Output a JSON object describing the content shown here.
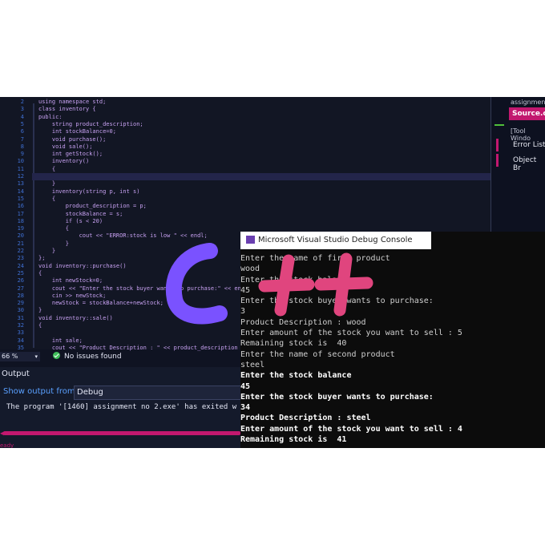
{
  "editor": {
    "line_numbers": [
      "2",
      "3",
      "4",
      "5",
      "6",
      "7",
      "8",
      "9",
      "10",
      "11",
      "12",
      "13",
      "14",
      "15",
      "16",
      "17",
      "18",
      "19",
      "20",
      "21",
      "22",
      "23",
      "24",
      "25",
      "26",
      "27",
      "28",
      "29",
      "30",
      "31",
      "32",
      "33",
      "34",
      "35"
    ],
    "lines": [
      "using namespace std;",
      "class inventory {",
      "public:",
      "    string product_description;",
      "    int stockBalance=0;",
      "    void purchase();",
      "    void sale();",
      "    int getStock();",
      "    inventory()",
      "    {",
      "",
      "    }",
      "    inventory(string p, int s)",
      "    {",
      "        product_description = p;",
      "        stockBalance = s;",
      "        if (s < 20)",
      "        {",
      "            cout << \"ERROR:stock is low \" << endl;",
      "        }",
      "    }",
      "};",
      "void inventory::purchase()",
      "{",
      "    int newStock=0;",
      "    cout << \"Enter the stock buyer wants to purchase:\" << endl;",
      "    cin >> newStock;",
      "    newStock = stockBalance+newStock;",
      "}",
      "void inventory::sale()",
      "{",
      "",
      "    int sale;",
      "    cout << \"Product Description : \" << product_description"
    ]
  },
  "right_panel": {
    "header": "assignment",
    "source_tab": "Source.c",
    "tool_window": "[Tool Windo",
    "items": [
      "Error List",
      "Object Br"
    ]
  },
  "status": {
    "zoom": "66 %",
    "issues": "No issues found"
  },
  "output": {
    "title": "Output",
    "show_from_label": "Show output from:",
    "source": "Debug",
    "message": "The program '[1460] assignment no 2.exe' has exited w",
    "ready": "eady"
  },
  "console": {
    "title": "Microsoft Visual Studio Debug Console",
    "lines": [
      "Enter the name of first product",
      "wood",
      "Enter the stock balance",
      "45",
      "Enter the stock buyer wants to purchase:",
      "3",
      "Product Description : wood",
      "Enter amount of the stock you want to sell : 5",
      "Remaining stock is  40",
      "Enter the name of second product",
      "steel",
      "Enter the stock balance",
      "45",
      "Enter the stock buyer wants to purchase:",
      "34",
      "Product Description : steel",
      "Enter amount of the stock you want to sell : 4",
      "Remaining stock is  41"
    ],
    "bold_from": 11
  },
  "overlay": {
    "logo_text": "C++"
  },
  "colors": {
    "accent": "#c2186f",
    "editor_bg": "#121624",
    "logo_c": "#7a52ff",
    "logo_plus": "#e0457e"
  }
}
